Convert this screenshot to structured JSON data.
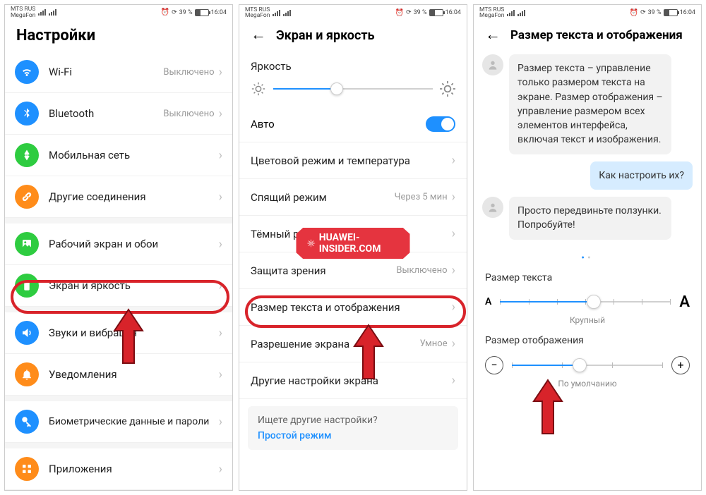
{
  "status": {
    "carrier1": "MTS RUS",
    "carrier2": "MegaFon",
    "battery_text": "39 %",
    "time": "16:04"
  },
  "screen1": {
    "title": "Настройки",
    "items": [
      {
        "label": "Wi-Fi",
        "value": "Выключено",
        "color": "#1e90ff",
        "icon": "wifi"
      },
      {
        "label": "Bluetooth",
        "value": "Выключено",
        "color": "#1e90ff",
        "icon": "bt"
      },
      {
        "label": "Мобильная сеть",
        "value": "",
        "color": "#2ecc40",
        "icon": "mobile"
      },
      {
        "label": "Другие соединения",
        "value": "",
        "color": "#ff8c1a",
        "icon": "link"
      },
      {
        "label": "Рабочий экран и обои",
        "value": "",
        "color": "#2ecc40",
        "icon": "wall"
      },
      {
        "label": "Экран и яркость",
        "value": "",
        "color": "#2ecc40",
        "icon": "display"
      },
      {
        "label": "Звуки и вибрация",
        "value": "",
        "color": "#1e90ff",
        "icon": "sound"
      },
      {
        "label": "Уведомления",
        "value": "",
        "color": "#ff8c1a",
        "icon": "bell"
      },
      {
        "label": "Биометрические данные и пароли",
        "value": "",
        "color": "#1e90ff",
        "icon": "key"
      },
      {
        "label": "Приложения",
        "value": "",
        "color": "#ff8c1a",
        "icon": "apps"
      }
    ]
  },
  "screen2": {
    "title": "Экран и яркость",
    "brightness_label": "Яркость",
    "auto_label": "Авто",
    "items": [
      {
        "label": "Цветовой режим и температура",
        "value": ""
      },
      {
        "label": "Спящий режим",
        "value": "Через 5 мин"
      },
      {
        "label": "Тёмный режим",
        "value": ""
      },
      {
        "label": "Защита зрения",
        "value": "Выключено"
      },
      {
        "label": "Размер текста и отображения",
        "value": ""
      },
      {
        "label": "Разрешение экрана",
        "value": "Умное"
      },
      {
        "label": "Другие настройки экрана",
        "value": ""
      }
    ],
    "tip_q": "Ищете другие настройки?",
    "tip_a": "Простой режим",
    "watermark": "HUAWEI-INSIDER.COM",
    "brightness_pct": 40
  },
  "screen3": {
    "title": "Размер текста и отображения",
    "msg1": "Размер текста – управление только размером текста на экране. Размер отображения – управление размером всех элементов интерфейса, включая текст и изображения.",
    "msg2": "Как настроить их?",
    "msg3": "Просто передвиньте ползунки. Попробуйте!",
    "text_size_label": "Размер текста",
    "text_size_caption": "Крупный",
    "display_size_label": "Размер отображения",
    "display_size_caption": "По умолчанию",
    "text_slider_pct": 55,
    "display_slider_pct": 45
  }
}
